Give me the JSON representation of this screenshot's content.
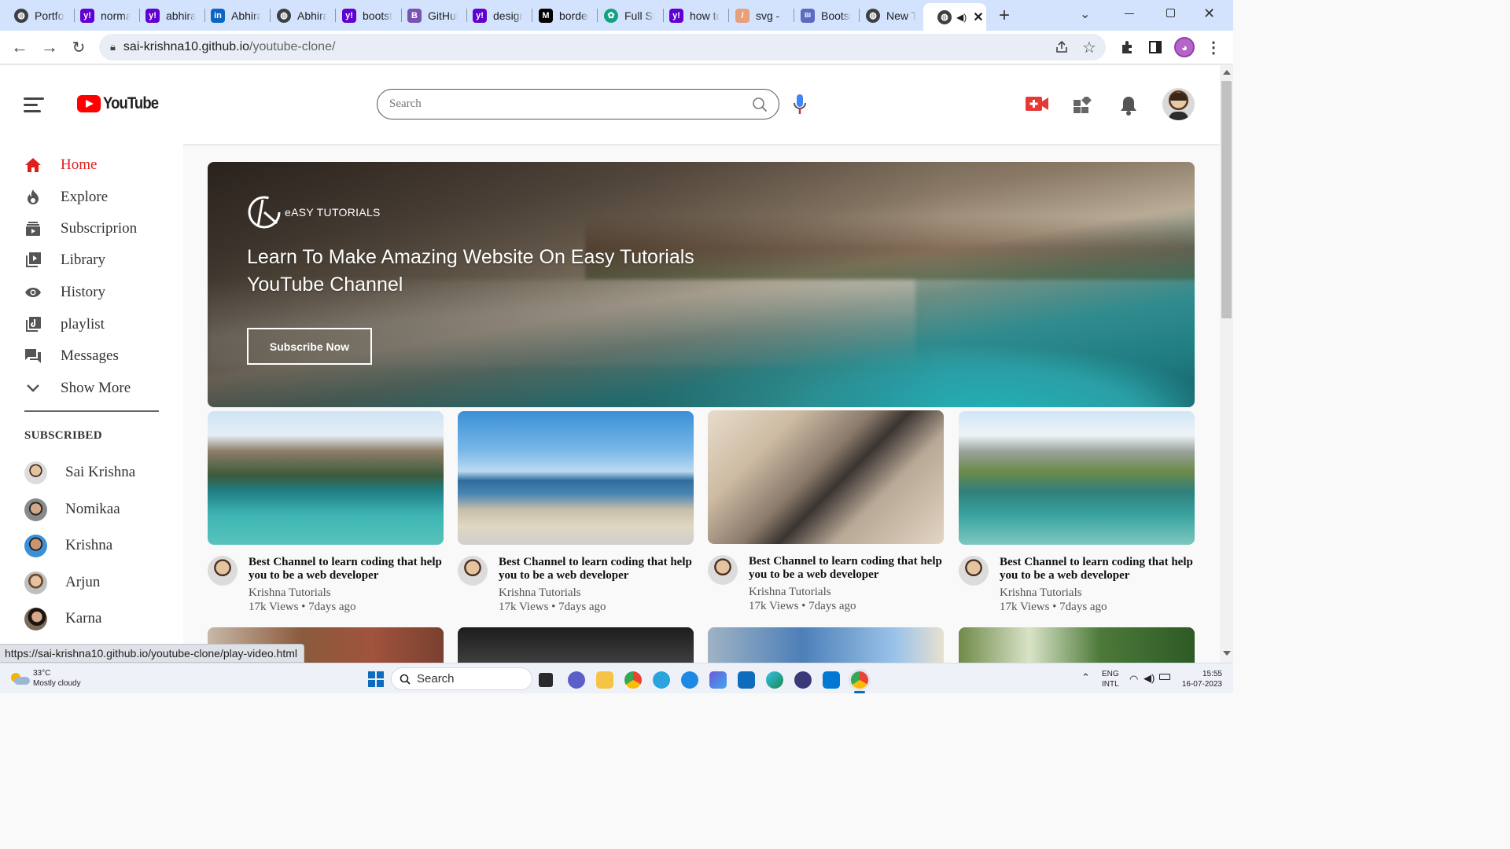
{
  "browser": {
    "tabs": [
      {
        "title": "Portfolio",
        "icon": "globe-icon",
        "color": "#3c4043"
      },
      {
        "title": "normal",
        "icon": "yahoo-icon",
        "color": "#6001d2"
      },
      {
        "title": "abhiram",
        "icon": "yahoo-icon",
        "color": "#6001d2"
      },
      {
        "title": "Abhiram",
        "icon": "linkedin-icon",
        "color": "#0a66c2"
      },
      {
        "title": "Abhiram",
        "icon": "globe-icon",
        "color": "#3c4043"
      },
      {
        "title": "bootstrap",
        "icon": "yahoo-icon",
        "color": "#6001d2"
      },
      {
        "title": "GitHub",
        "icon": "bootstrap-icon",
        "color": "#7952b3"
      },
      {
        "title": "design",
        "icon": "yahoo-icon",
        "color": "#6001d2"
      },
      {
        "title": "border",
        "icon": "mdn-icon",
        "color": "#000000"
      },
      {
        "title": "Full Stack",
        "icon": "openai-icon",
        "color": "#10a37f"
      },
      {
        "title": "how to",
        "icon": "yahoo-icon",
        "color": "#6001d2"
      },
      {
        "title": "svg - ",
        "icon": "svgrepo-icon",
        "color": "#e8a07a"
      },
      {
        "title": "Bootstrap",
        "icon": "bootstrap-icons-icon",
        "color": "#5c6bc0"
      },
      {
        "title": "New Tab",
        "icon": "globe-icon",
        "color": "#3c4043"
      }
    ],
    "active_tab_icon": "globe-icon",
    "url_host": "sai-krishna10.github.io",
    "url_path": "/youtube-clone/",
    "status_url": "https://sai-krishna10.github.io/youtube-clone/play-video.html"
  },
  "header": {
    "logo_text": "YouTube",
    "search_placeholder": "Search",
    "icons": [
      "menu-icon",
      "search-icon",
      "mic-icon",
      "upload-video-icon",
      "apps-icon",
      "notification-bell-icon",
      "profile-avatar"
    ]
  },
  "sidebar": {
    "nav": [
      {
        "label": "Home",
        "icon": "home-icon",
        "active": true
      },
      {
        "label": "Explore",
        "icon": "explore-icon"
      },
      {
        "label": "Subscriprion",
        "icon": "subscription-icon"
      },
      {
        "label": "Library",
        "icon": "library-icon"
      },
      {
        "label": "History",
        "icon": "history-icon"
      },
      {
        "label": "playlist",
        "icon": "playlist-icon"
      },
      {
        "label": "Messages",
        "icon": "messages-icon"
      },
      {
        "label": "Show More",
        "icon": "chevron-down-icon"
      }
    ],
    "subscribed_heading": "SUBSCRIBED",
    "subscriptions": [
      {
        "name": "Sai Krishna"
      },
      {
        "name": "Nomikaa"
      },
      {
        "name": "Krishna"
      },
      {
        "name": "Arjun"
      },
      {
        "name": "Karna"
      }
    ]
  },
  "banner": {
    "brand": "eASY TUTORIALS",
    "headline_line1": "Learn To Make Amazing Website On Easy Tutorials",
    "headline_line2": "YouTube Channel",
    "button_label": "Subscribe Now"
  },
  "videos": [
    {
      "title": "Best Channel to learn coding that help you to be a web developer",
      "channel": "Krishna Tutorials",
      "stats": "17k Views • 7days ago"
    },
    {
      "title": "Best Channel to learn coding that help you to be a web developer",
      "channel": "Krishna Tutorials",
      "stats": "17k Views • 7days ago"
    },
    {
      "title": "Best Channel to learn coding that help you to be a web developer",
      "channel": "Krishna Tutorials",
      "stats": "17k Views • 7days ago"
    },
    {
      "title": "Best Channel to learn coding that help you to be a web developer",
      "channel": "Krishna Tutorials",
      "stats": "17k Views • 7days ago"
    }
  ],
  "taskbar": {
    "weather_temp": "33°C",
    "weather_desc": "Mostly cloudy",
    "search_label": "Search",
    "lang_line1": "ENG",
    "lang_line2": "INTL",
    "time": "15:55",
    "date": "16-07-2023"
  },
  "colors": {
    "youtube_red": "#ff0000",
    "active_nav": "#e01e1e",
    "tab_strip": "#d3e3fd"
  }
}
